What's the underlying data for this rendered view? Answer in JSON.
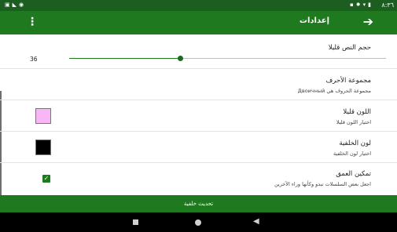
{
  "status_bar": {
    "time": "٨:٣٦",
    "right_icons": [
      "battery-icon",
      "wifi-icon",
      "settings-gear-icon",
      "notification-icon"
    ],
    "left_icons": [
      "image-icon",
      "signal-icon",
      "location-icon"
    ]
  },
  "app_bar": {
    "title": "إعدادات",
    "back_icon": "arrow-right-icon",
    "menu_icon": "more-vertical-icon"
  },
  "settings": {
    "text_size": {
      "label": "حجم النص قليلا",
      "value": "36",
      "slider_fraction": 0.35
    },
    "charset": {
      "label": "مجموعة الأحرف",
      "summary": "مجموعة الحروف هي Двоичный"
    },
    "text_color": {
      "label": "اللون قليلا",
      "summary": "اختيار اللون قليلا",
      "color": "#f9b6f7"
    },
    "background_color": {
      "label": "لون الخلفية",
      "summary": "اختيار لون الخلفية",
      "color": "#000000"
    },
    "depth": {
      "label": "تمكين العمق",
      "summary": "اجعل بعض السلسلات تبدو وكأنها وراء الآخرين",
      "checked": true
    }
  },
  "bottom_bar": {
    "label": "تحديث خلفية"
  },
  "colors": {
    "status_bar": "#1b5e20",
    "app_bar": "#1f7a1f",
    "accent": "#1f7a1f"
  },
  "nav_bar": {
    "icons": [
      "back-triangle-icon",
      "home-circle-icon",
      "recents-square-icon"
    ]
  }
}
